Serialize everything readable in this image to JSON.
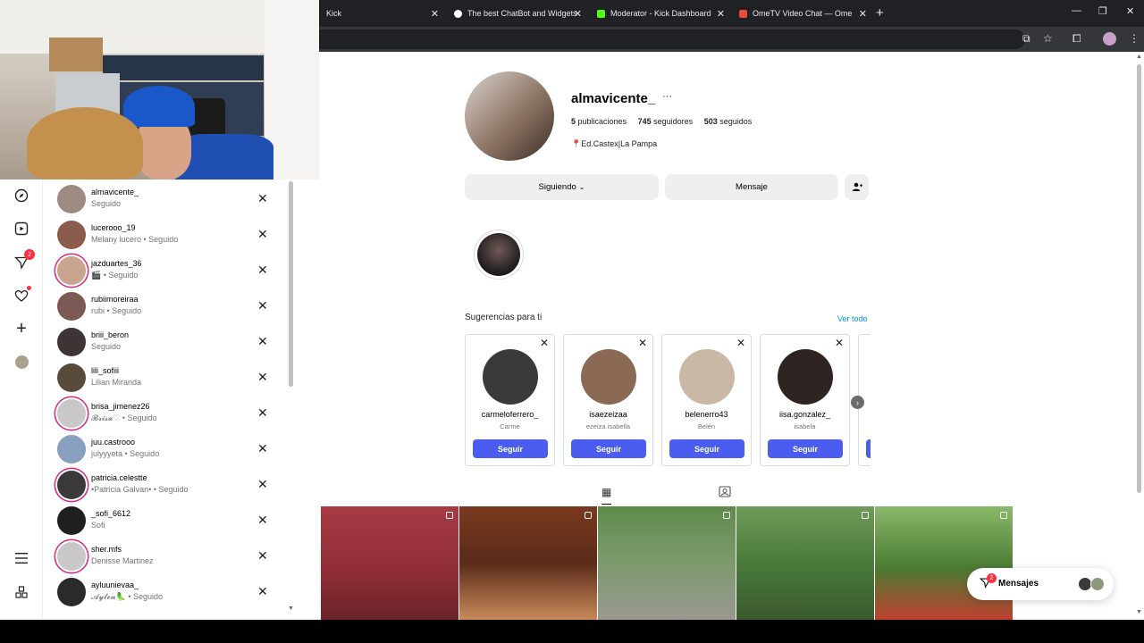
{
  "browser": {
    "tabs": [
      {
        "title": "Kick",
        "favicon_color": "#202124"
      },
      {
        "title": "The best ChatBot and Widgets",
        "favicon_color": "#ffffff"
      },
      {
        "title": "Moderator - Kick Dashboard",
        "favicon_color": "#53fc18"
      },
      {
        "title": "OmeTV Video Chat — Ome",
        "favicon_color": "#e74c3c"
      }
    ],
    "new_tab": "+",
    "window_controls": [
      "—",
      "❐",
      "✕"
    ],
    "toolbar_icons": [
      "cast-icon",
      "star-icon",
      "extensions-icon",
      "menu-icon"
    ]
  },
  "nav": {
    "icons": [
      "compass-icon",
      "reels-icon",
      "messages-icon",
      "heart-icon",
      "plus-icon",
      "avatar",
      "menu-icon",
      "apps-icon"
    ],
    "messages_badge": "2"
  },
  "following_list": [
    {
      "username": "almavicente_",
      "sub": "Seguido",
      "ring": false,
      "color": "#9b8b80"
    },
    {
      "username": "lucerooo_19",
      "sub": "Melany lucero • Seguido",
      "ring": false,
      "color": "#8a5a4a"
    },
    {
      "username": "jazduartes_36",
      "sub": "🎬 • Seguido",
      "ring": true,
      "color": "#c9a48e"
    },
    {
      "username": "rubiimoreiraa",
      "sub": "rubi • Seguido",
      "ring": false,
      "color": "#7a5a52"
    },
    {
      "username": "briii_beron",
      "sub": "Seguido",
      "ring": false,
      "color": "#3d3533"
    },
    {
      "username": "lili_sofiii",
      "sub": "Lilian Miranda",
      "ring": false,
      "color": "#5a4a3a"
    },
    {
      "username": "brisa_jimenez26",
      "sub": "𝓑𝓻𝓲𝓼𝓪♡ • Seguido",
      "ring": true,
      "color": "#c8c8c8"
    },
    {
      "username": "juu.castrooo",
      "sub": "julyyyeta • Seguido",
      "ring": false,
      "color": "#8aa0c0"
    },
    {
      "username": "patricia.celestte",
      "sub": "•Patricia Galvan• • Seguido",
      "ring": true,
      "color": "#3a3a3a"
    },
    {
      "username": "_sofi_6612",
      "sub": "Sofi",
      "ring": false,
      "color": "#1f1f1f"
    },
    {
      "username": "sher.mfs",
      "sub": "Denisse Martinez",
      "ring": true,
      "color": "#c8c8c8"
    },
    {
      "username": "ayluunievaa_",
      "sub": "𝓐𝔂𝓵𝓮𝓷🦜 • Seguido",
      "ring": false,
      "color": "#2a2a2a"
    }
  ],
  "profile": {
    "username": "almavicente_",
    "more": "···",
    "posts_count": "5",
    "posts_label": "publicaciones",
    "followers_count": "745",
    "followers_label": "seguidores",
    "following_count": "503",
    "following_label": "seguidos",
    "bio": "Ed.Castex|La Pampa",
    "following_button": "Siguiendo",
    "message_button": "Mensaje"
  },
  "suggestions": {
    "title": "Sugerencias para ti",
    "see_all": "Ver todo",
    "follow_label": "Seguir",
    "cards": [
      {
        "username": "carmeloferrero_",
        "name": "Carme",
        "color": "#3a3a3a"
      },
      {
        "username": "isaezeizaa",
        "name": "ezeiza isabella",
        "color": "#8b6a55"
      },
      {
        "username": "belenerro43",
        "name": "Belén",
        "color": "#c9b8a6"
      },
      {
        "username": "iisa.gonzalez_",
        "name": "isabela",
        "color": "#2e2522"
      }
    ]
  },
  "posts": [
    {
      "bg": "linear-gradient(180deg,#a83a44 0%,#8e2d36 60%,#6a2328 100%)"
    },
    {
      "bg": "linear-gradient(180deg,#7a3a1e 0%,#5a2a1a 50%,#c98a5a 100%)"
    },
    {
      "bg": "linear-gradient(180deg,#5f8a4a 0%,#7a9a6a 45%,#9a9890 100%)"
    },
    {
      "bg": "linear-gradient(180deg,#6f9a5a 0%,#4a7a3a 50%,#3a5a2e 100%)"
    },
    {
      "bg": "linear-gradient(180deg,#8ab86a 0%,#4a7a32 55%,#c04030 100%)"
    }
  ],
  "messages_pill": {
    "label": "Mensajes",
    "badge": "2"
  }
}
